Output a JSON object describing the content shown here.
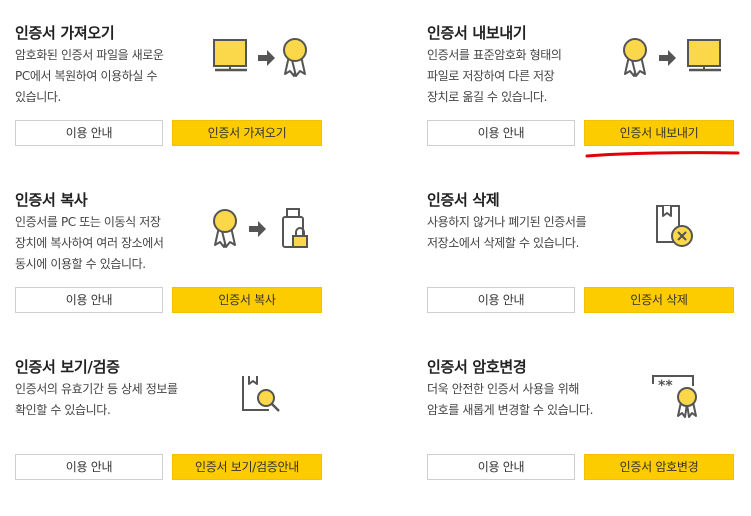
{
  "accent_color": "#fccb00",
  "annotation_color": "#e0000b",
  "cards": [
    {
      "title": "인증서 가져오기",
      "desc": [
        "암호화된 인증서 파일을 새로운",
        "PC에서 복원하여 이용하실 수",
        "있습니다."
      ],
      "guide_label": "이용 안내",
      "action_label": "인증서 가져오기",
      "icons": [
        "monitor-icon",
        "arrow-right-icon",
        "certificate-medal-icon"
      ]
    },
    {
      "title": "인증서 내보내기",
      "desc": [
        "인증서를 표준암호화 형태의",
        "파일로 저장하여 다른 저장",
        "장치로 옮길 수 있습니다."
      ],
      "guide_label": "이용 안내",
      "action_label": "인증서 내보내기",
      "icons": [
        "certificate-medal-icon",
        "arrow-right-icon",
        "monitor-icon"
      ]
    },
    {
      "title": "인증서 복사",
      "desc": [
        "인증서를 PC 또는 이동식 저장",
        "장치에 복사하여 여러 장소에서",
        "동시에 이용할 수 있습니다."
      ],
      "guide_label": "이용 안내",
      "action_label": "인증서 복사",
      "icons": [
        "certificate-medal-icon",
        "arrow-right-icon",
        "usb-lock-icon"
      ]
    },
    {
      "title": "인증서 삭제",
      "desc": [
        "사용하지 않거나 폐기된 인증서를",
        "저장소에서 삭제할 수 있습니다."
      ],
      "guide_label": "이용 안내",
      "action_label": "인증서 삭제",
      "icons": [
        "certificate-delete-icon"
      ]
    },
    {
      "title": "인증서 보기/검증",
      "desc": [
        "인증서의 유효기간 등 상세 정보를",
        "확인할 수 있습니다."
      ],
      "guide_label": "이용 안내",
      "action_label": "인증서 보기/검증안내",
      "icons": [
        "certificate-search-icon"
      ]
    },
    {
      "title": "인증서 암호변경",
      "desc": [
        "더욱 안전한 인증서 사용을 위해",
        "암호를 새롭게 변경할 수 있습니다."
      ],
      "guide_label": "이용 안내",
      "action_label": "인증서 암호변경",
      "icons": [
        "password-certificate-icon"
      ]
    }
  ]
}
